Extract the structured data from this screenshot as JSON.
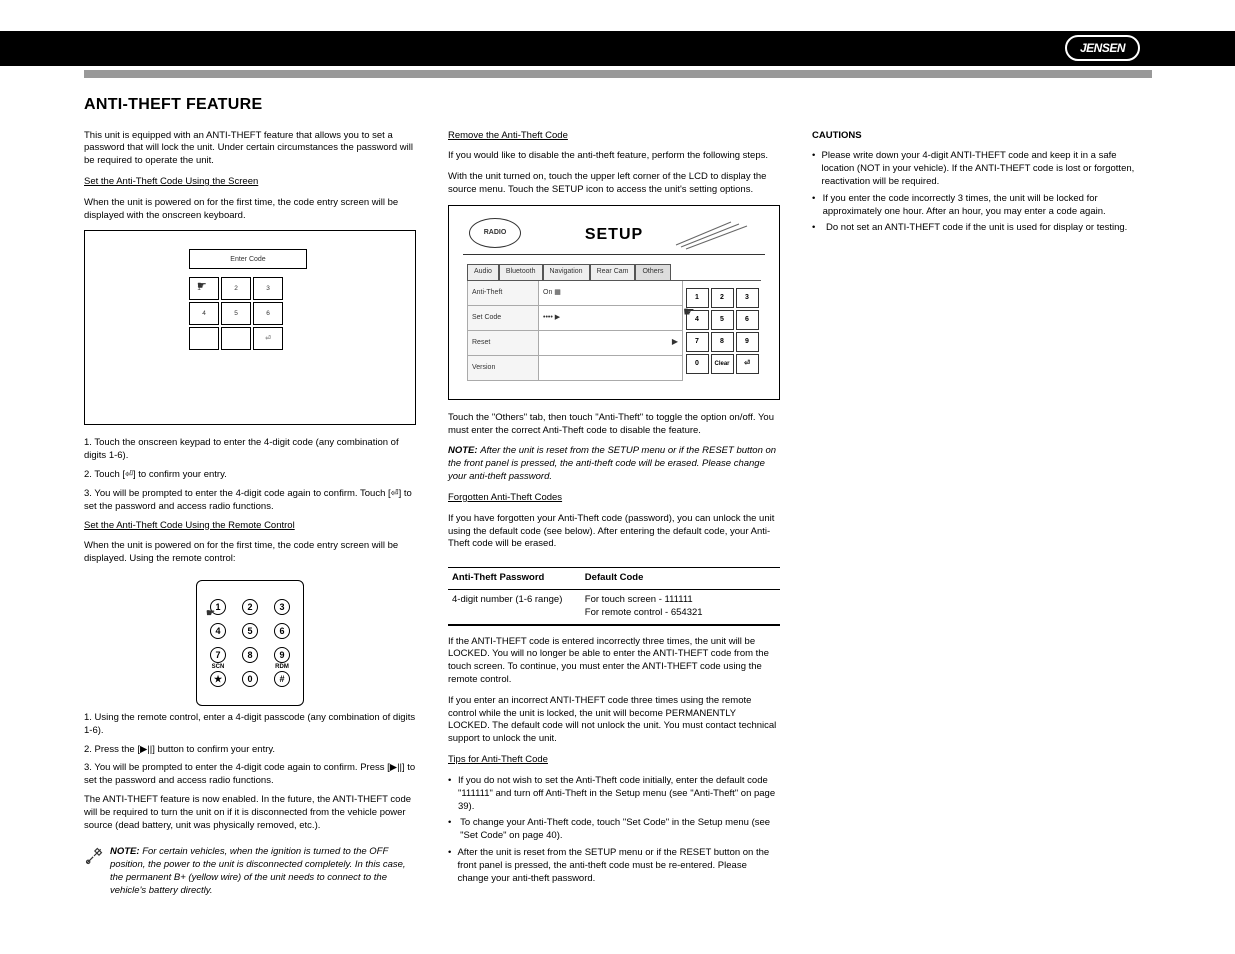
{
  "header": {
    "brand": "JENSEN",
    "heading": "ANTI-THEFT FEATURE"
  },
  "col1": {
    "p1": "This unit is equipped with an ANTI-THEFT feature that allows you to set a password that will lock the unit. Under certain circumstances the password will be required to operate the unit.",
    "p2_label": "Set the Anti-Theft Code Using the Screen",
    "p2": "When the unit is powered on for the first time, the code entry screen will be displayed with the onscreen keyboard.",
    "fig1": {
      "code_label": "Enter Code",
      "grid": [
        "1",
        "2",
        "3",
        "4",
        "5",
        "6",
        "",
        "",
        "⏎"
      ]
    },
    "s1a": "1. Touch the onscreen keypad to enter the 4-digit code (any combination of digits 1-6).",
    "s1b": "2. Touch [⏎] to confirm your entry.",
    "s1c": "3. You will be prompted to enter the 4-digit code again to confirm. Touch [⏎] to set the password and access radio functions.",
    "p3_label": "Set the Anti-Theft Code Using the Remote Control",
    "p3": "When the unit is powered on for the first time, the code entry screen will be displayed. Using the remote control:",
    "keypad": {
      "keys": [
        "1",
        "2",
        "3",
        "4",
        "5",
        "6",
        "7",
        "8",
        "9",
        "★",
        "0",
        "#"
      ],
      "sub7": "SCN",
      "sub9": "RDM"
    },
    "s2a": "1. Using the remote control, enter a 4-digit passcode (any combination of digits 1-6).",
    "s2b": "2. Press the [▶||] button to confirm your entry.",
    "s2c": "3. You will be prompted to enter the 4-digit code again to confirm. Press [▶||] to set the password and access radio functions.",
    "p4a": "The ANTI-THEFT feature is now enabled. In the future, the ANTI-THEFT code will be required to turn the unit on if it is disconnected from the vehicle power source (dead battery, unit was physically removed, etc.).",
    "note1_prefix": "NOTE: ",
    "note1": "For certain vehicles, when the ignition is turned to the OFF position, the power to the unit is disconnected completely. In this case, the permanent B+ (yellow wire) of the unit needs to connect to the vehicle's battery directly."
  },
  "col2": {
    "p1_label": "Remove the Anti-Theft Code",
    "p1": "If you would like to disable the anti-theft feature, perform the following steps.",
    "p2": "With the unit turned on, touch the upper left corner of the LCD to display the source menu. Touch the SETUP icon to access the unit's setting options.",
    "fig2": {
      "radio": "RADIO",
      "setup_label": "SETUP",
      "tabs": [
        "Audio",
        "Bluetooth",
        "Navigation",
        "Rear Cam",
        "Others"
      ],
      "left_labels": [
        "Anti-Theft",
        "Set Code",
        "Reset",
        "Version"
      ],
      "mid_cells": [
        "On   ▦",
        "•••• ▶",
        "▶"
      ],
      "numpad": [
        "1",
        "2",
        "3",
        "4",
        "5",
        "6",
        "7",
        "8",
        "9",
        "0",
        "Clear",
        "⏎"
      ]
    },
    "tabs_p": "Touch the \"Others\" tab, then touch \"Anti-Theft\" to toggle the option on/off. You must enter the correct Anti-Theft code to disable the feature.",
    "note1_prefix": "NOTE: ",
    "note1": "After the unit is reset from the SETUP menu or if the RESET button on the front panel is pressed, the anti-theft code will be erased. Please change your anti-theft password.",
    "forgot_label": "Forgotten Anti-Theft Codes",
    "forgot_p": "If you have forgotten your Anti-Theft code (password), you can unlock the unit using the default code (see below). After entering the default code, your Anti-Theft code will be erased.",
    "table": {
      "h1": "Anti-Theft Password",
      "h2": "Default Code",
      "r1c1": "4-digit number (1-6 range)",
      "r1c2_a": "For touch screen - 111111",
      "r1c2_b": "For remote control - 654321"
    },
    "important_p": "If the ANTI-THEFT code is entered incorrectly three times, the unit will be LOCKED. You will no longer be able to enter the ANTI-THEFT code from the touch screen. To continue, you must enter the ANTI-THEFT code using the remote control.",
    "locked_p": "If you enter an incorrect ANTI-THEFT code three times using the remote control while the unit is locked, the unit will become PERMANENTLY LOCKED. The default code will not unlock the unit. You must contact technical support to unlock the unit.",
    "tips_label": "Tips for Anti-Theft Code",
    "b1": "If you do not wish to set the Anti-Theft code initially, enter the default code \"111111\" and turn off Anti-Theft in the Setup menu (see \"Anti-Theft\" on page 39).",
    "b2": "To change your Anti-Theft code, touch \"Set Code\" in the Setup menu (see \"Set Code\" on page 40).",
    "b3": "After the unit is reset from the SETUP menu or if the RESET button on the front panel is pressed, the anti-theft code must be re-entered. Please change your anti-theft password."
  },
  "col3": {
    "caution_label": "CAUTIONS",
    "c1": "Please write down your 4-digit ANTI-THEFT code and keep it in a safe location (NOT in your vehicle). If the ANTI-THEFT code is lost or forgotten, reactivation will be required.",
    "c2": "If you enter the code incorrectly 3 times, the unit will be locked for approximately one hour. After an hour, you may enter a code again.",
    "c3": "Do not set an ANTI-THEFT code if the unit is used for display or testing."
  }
}
